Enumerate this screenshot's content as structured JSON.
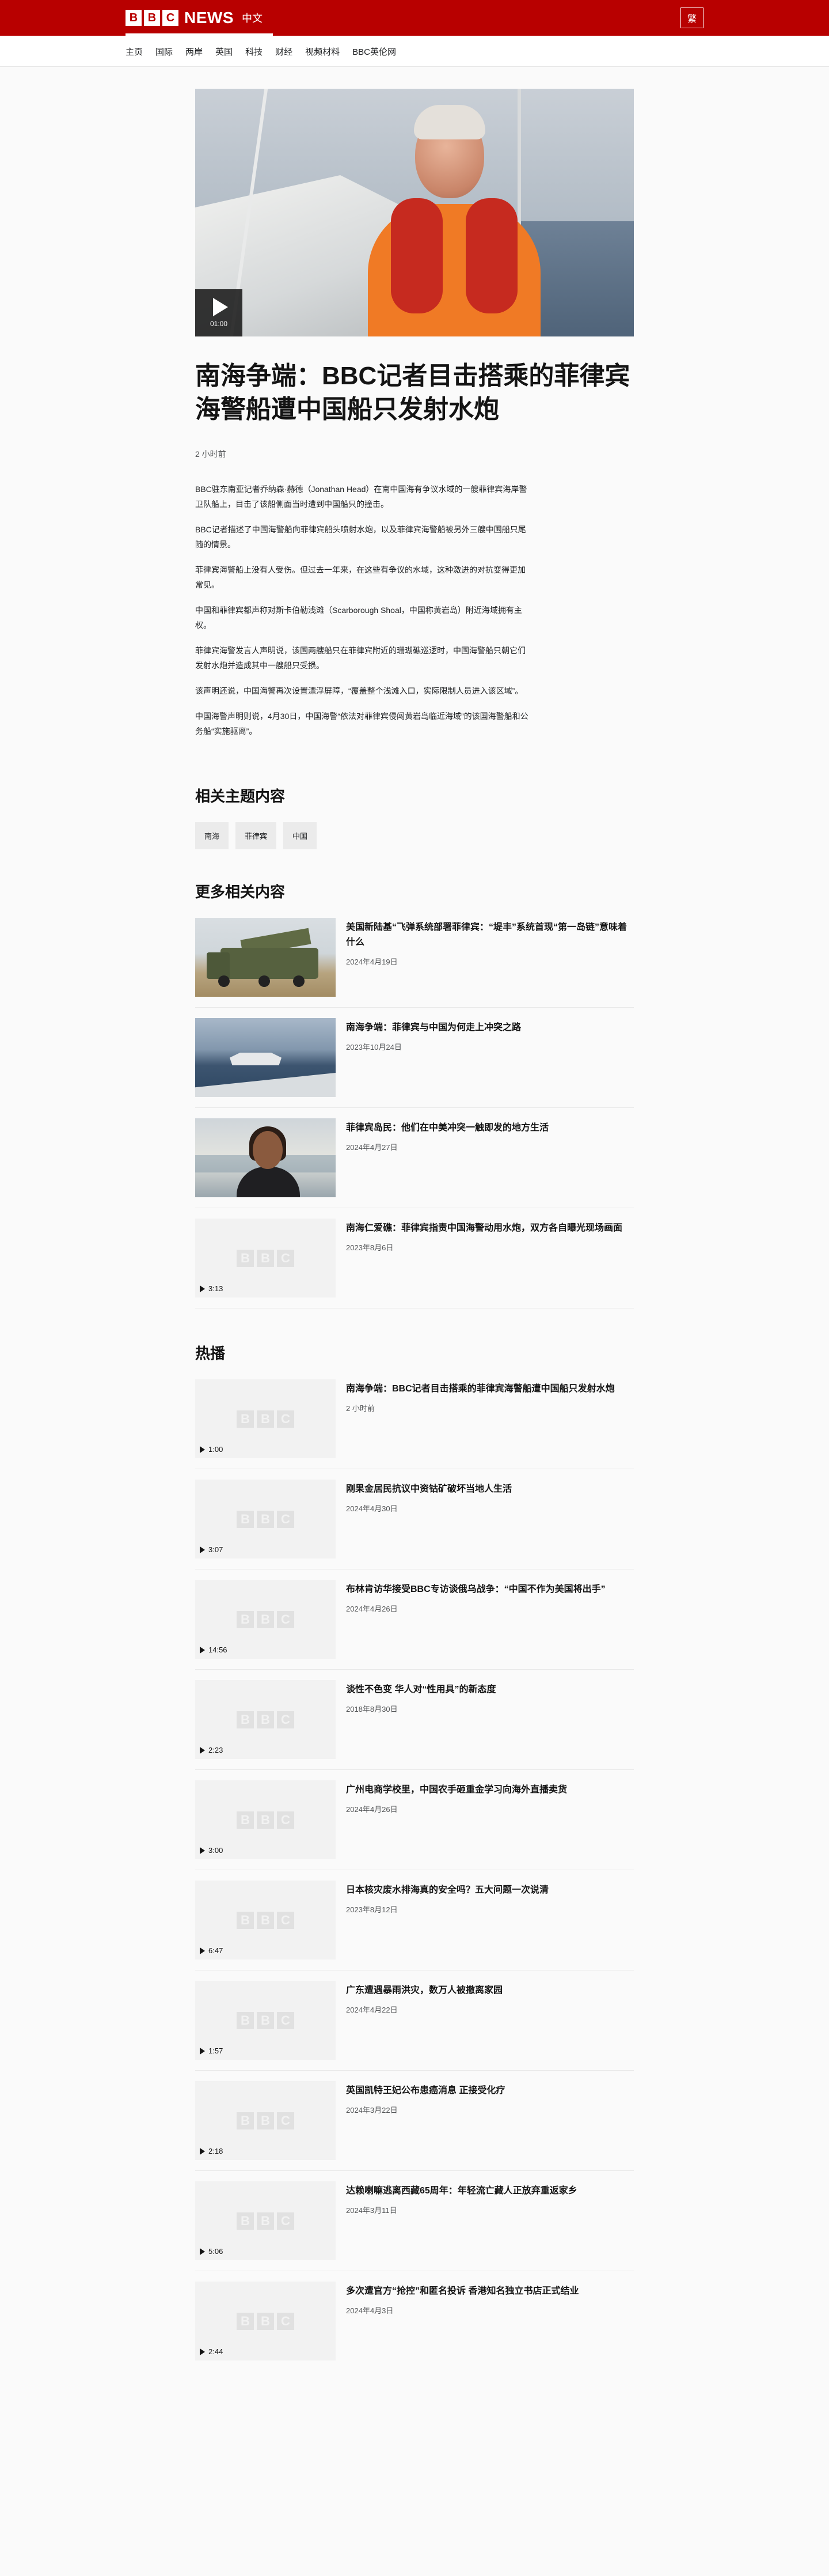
{
  "header": {
    "brand_letters": [
      "B",
      "B",
      "C"
    ],
    "brand_news": "NEWS",
    "brand_lang": "中文",
    "lang_toggle": "繁"
  },
  "nav": {
    "items": [
      "主页",
      "国际",
      "两岸",
      "英国",
      "科技",
      "财经",
      "视频材料",
      "BBC英伦网"
    ]
  },
  "hero": {
    "duration": "01:00"
  },
  "article": {
    "headline": "南海争端：BBC记者目击搭乘的菲律宾海警船遭中国船只发射水炮",
    "timestamp": "2 小时前",
    "paragraphs": [
      "BBC驻东南亚记者乔纳森·赫德（Jonathan Head）在南中国海有争议水域的一艘菲律宾海岸警卫队船上，目击了该船侧面当时遭到中国船只的撞击。",
      "BBC记者描述了中国海警船向菲律宾船头喷射水炮，以及菲律宾海警船被另外三艘中国船只尾随的情景。",
      "菲律宾海警船上没有人受伤。但过去一年来，在这些有争议的水域，这种激进的对抗变得更加常见。",
      "中国和菲律宾都声称对斯卡伯勒浅滩（Scarborough Shoal，中国称黄岩岛）附近海域拥有主权。",
      "菲律宾海警发言人声明说，该国两艘船只在菲律宾附近的珊瑚礁巡逻时，中国海警船只朝它们发射水炮并造成其中一艘船只受损。",
      "该声明还说，中国海警再次设置漂浮屏障，“覆盖整个浅滩入口，实际限制人员进入该区域”。",
      "中国海警声明则说，4月30日，中国海警“依法对菲律宾侵闯黄岩岛临近海域”的该国海警船和公务船“实施驱离”。"
    ]
  },
  "topics": {
    "title": "相关主题内容",
    "tags": [
      "南海",
      "菲律宾",
      "中国"
    ]
  },
  "related": {
    "title": "更多相关内容",
    "items": [
      {
        "title": "美国新陆基“飞弹系统部署菲律宾：“堤丰”系统首现“第一岛链”意味着什么",
        "date": "2024年4月19日",
        "image": "military-vehicle",
        "duration": ""
      },
      {
        "title": "南海争端：菲律宾与中国为何走上冲突之路",
        "date": "2023年10月24日",
        "image": "ships-at-sea",
        "duration": ""
      },
      {
        "title": "菲律宾岛民：他们在中美冲突一触即发的地方生活",
        "date": "2024年4月27日",
        "image": "woman-portrait",
        "duration": ""
      },
      {
        "title": "南海仁爱礁：菲律宾指责中国海警动用水炮，双方各自曝光现场画面",
        "date": "2023年8月6日",
        "image": "placeholder",
        "duration": "3:13"
      }
    ]
  },
  "popular": {
    "title": "热播",
    "items": [
      {
        "title": "南海争端：BBC记者目击搭乘的菲律宾海警船遭中国船只发射水炮",
        "date": "2 小时前",
        "duration": "1:00"
      },
      {
        "title": "刚果金居民抗议中资钴矿破坏当地人生活",
        "date": "2024年4月30日",
        "duration": "3:07"
      },
      {
        "title": "布林肯访华接受BBC专访谈俄乌战争：“中国不作为美国将出手”",
        "date": "2024年4月26日",
        "duration": "14:56"
      },
      {
        "title": "谈性不色变 华人对“性用具”的新态度",
        "date": "2018年8月30日",
        "duration": "2:23"
      },
      {
        "title": "广州电商学校里，中国农手砸重金学习向海外直播卖货",
        "date": "2024年4月26日",
        "duration": "3:00"
      },
      {
        "title": "日本核灾废水排海真的安全吗？五大问题一次说清",
        "date": "2023年8月12日",
        "duration": "6:47"
      },
      {
        "title": "广东遭遇暴雨洪灾，数万人被撤离家园",
        "date": "2024年4月22日",
        "duration": "1:57"
      },
      {
        "title": "英国凯特王妃公布患癌消息 正接受化疗",
        "date": "2024年3月22日",
        "duration": "2:18"
      },
      {
        "title": "达赖喇嘛逃离西藏65周年：年轻流亡藏人正放弃重返家乡",
        "date": "2024年3月11日",
        "duration": "5:06"
      },
      {
        "title": "多次遭官方“抢控”和匿名投诉 香港知名独立书店正式结业",
        "date": "2024年4月3日",
        "duration": "2:44"
      }
    ]
  },
  "colors": {
    "brand_red": "#b80000",
    "page_bg": "#fafafa",
    "text": "#141414",
    "meta_text": "#545658",
    "tag_bg": "#ebebeb"
  }
}
